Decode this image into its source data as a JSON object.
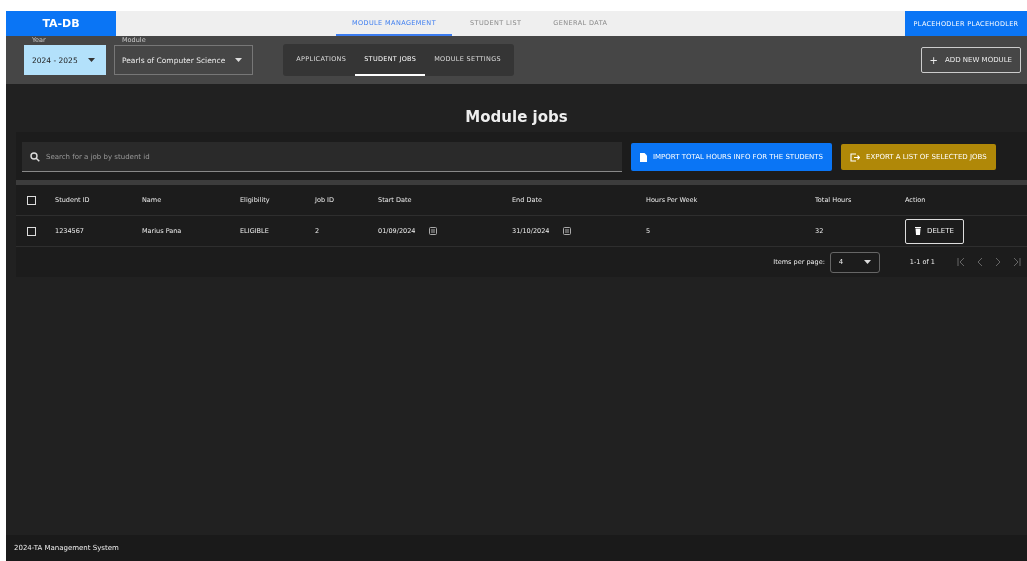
{
  "brand": "TA-DB",
  "nav_tabs": [
    {
      "label": "MODULE MANAGEMENT",
      "selected": true
    },
    {
      "label": "STUDENT LIST",
      "selected": false
    },
    {
      "label": "GENERAL DATA",
      "selected": false
    }
  ],
  "user_button": "PLACEHODLER PLACEHODLER",
  "filters": [
    {
      "label": "Year",
      "value": "2024 - 2025",
      "highlighted": true
    },
    {
      "label": "Module",
      "value": "Pearls of Computer Science",
      "highlighted": false
    }
  ],
  "sub_tabs": [
    {
      "label": "APPLICATIONS",
      "selected": false
    },
    {
      "label": "STUDENT JOBS",
      "selected": true
    },
    {
      "label": "MODULE SETTINGS",
      "selected": false
    }
  ],
  "add_button": {
    "icon": "+",
    "label": "ADD NEW MODULE"
  },
  "title": "Module jobs",
  "search": {
    "placeholder": "Search for a job by student id"
  },
  "actions": [
    {
      "kind": "import",
      "label": "IMPORT TOTAL HOURS INFO FOR THE STUDENTS"
    },
    {
      "kind": "export",
      "label": "EXPORT A LIST OF SELECTED JOBS"
    }
  ],
  "table": {
    "select_all_checked": false,
    "columns": [
      "Student ID",
      "Name",
      "Eligibility",
      "Job ID",
      "Start Date",
      "End Date",
      "Hours Per Week",
      "Total Hours",
      "Action"
    ],
    "rows": [
      {
        "checked": false,
        "student_id": "1234567",
        "name": "Marius Pana",
        "eligibility": "ELIGIBLE",
        "job_id": "2",
        "start_date": "01/09/2024",
        "end_date": "31/10/2024",
        "hours_per_week": "5",
        "total_hours": "32",
        "action": "DELETE"
      }
    ]
  },
  "paginator": {
    "label": "Items per page:",
    "page_size": "4",
    "range": "1-1 of 1"
  },
  "footer": "2024-TA Management System"
}
